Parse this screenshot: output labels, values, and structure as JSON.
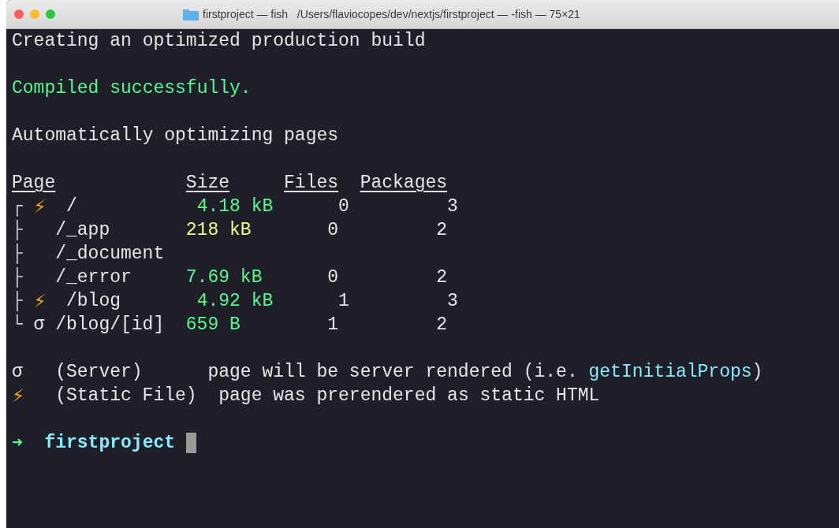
{
  "window": {
    "title": "firstproject — fish   /Users/flaviocopes/dev/nextjs/firstproject — -fish — 75×21"
  },
  "output": [
    {
      "kind": "line",
      "color": "#e6e6e6",
      "text": "Creating an optimized production build"
    },
    {
      "kind": "blank"
    },
    {
      "kind": "line",
      "color": "#5af78e",
      "text": "Compiled successfully."
    },
    {
      "kind": "blank"
    },
    {
      "kind": "line",
      "color": "#e6e6e6",
      "text": "Automatically optimizing pages"
    },
    {
      "kind": "blank"
    }
  ],
  "table": {
    "columns": [
      "Page",
      "Size",
      "Files",
      "Packages"
    ],
    "rows": [
      {
        "kind": "static",
        "tree": "┌",
        "symbol": "⚡",
        "page": "/",
        "size": {
          "text": "4.18 kB",
          "color": "#5af78e"
        },
        "files": "0",
        "packages": "3"
      },
      {
        "kind": "plain",
        "tree": "├",
        "page": "/_app",
        "size": {
          "text": "218 kB",
          "color": "#f1fa8c"
        },
        "files": "0",
        "packages": "2"
      },
      {
        "kind": "plain",
        "tree": "├",
        "page": "/_document"
      },
      {
        "kind": "plain",
        "tree": "├",
        "page": "/_error",
        "size": {
          "text": "7.69 kB",
          "color": "#5af78e"
        },
        "files": "0",
        "packages": "2"
      },
      {
        "kind": "static",
        "tree": "├",
        "symbol": "⚡",
        "page": "/blog",
        "size": {
          "text": "4.92 kB",
          "color": "#5af78e"
        },
        "files": "1",
        "packages": "3"
      },
      {
        "kind": "server",
        "tree": "└",
        "symbol": "σ",
        "page": "/blog/[id]",
        "size": {
          "text": "659 B",
          "color": "#5af78e"
        },
        "files": "1",
        "packages": "2"
      }
    ]
  },
  "legend": [
    {
      "kind": "server",
      "symbol": "σ",
      "label": "(Server)",
      "description": [
        {
          "text": "page will be server rendered (i.e. ",
          "color": "#e6e6e6"
        },
        {
          "text": "getInitialProps",
          "color": "#8be9fd"
        },
        {
          "text": ")",
          "color": "#e6e6e6"
        }
      ]
    },
    {
      "kind": "static",
      "symbol": "⚡",
      "label": "(Static File)",
      "description": [
        {
          "text": "page was prerendered as static HTML",
          "color": "#e6e6e6"
        }
      ]
    }
  ],
  "prompt": {
    "arrow": "➜",
    "directory": "firstproject"
  }
}
